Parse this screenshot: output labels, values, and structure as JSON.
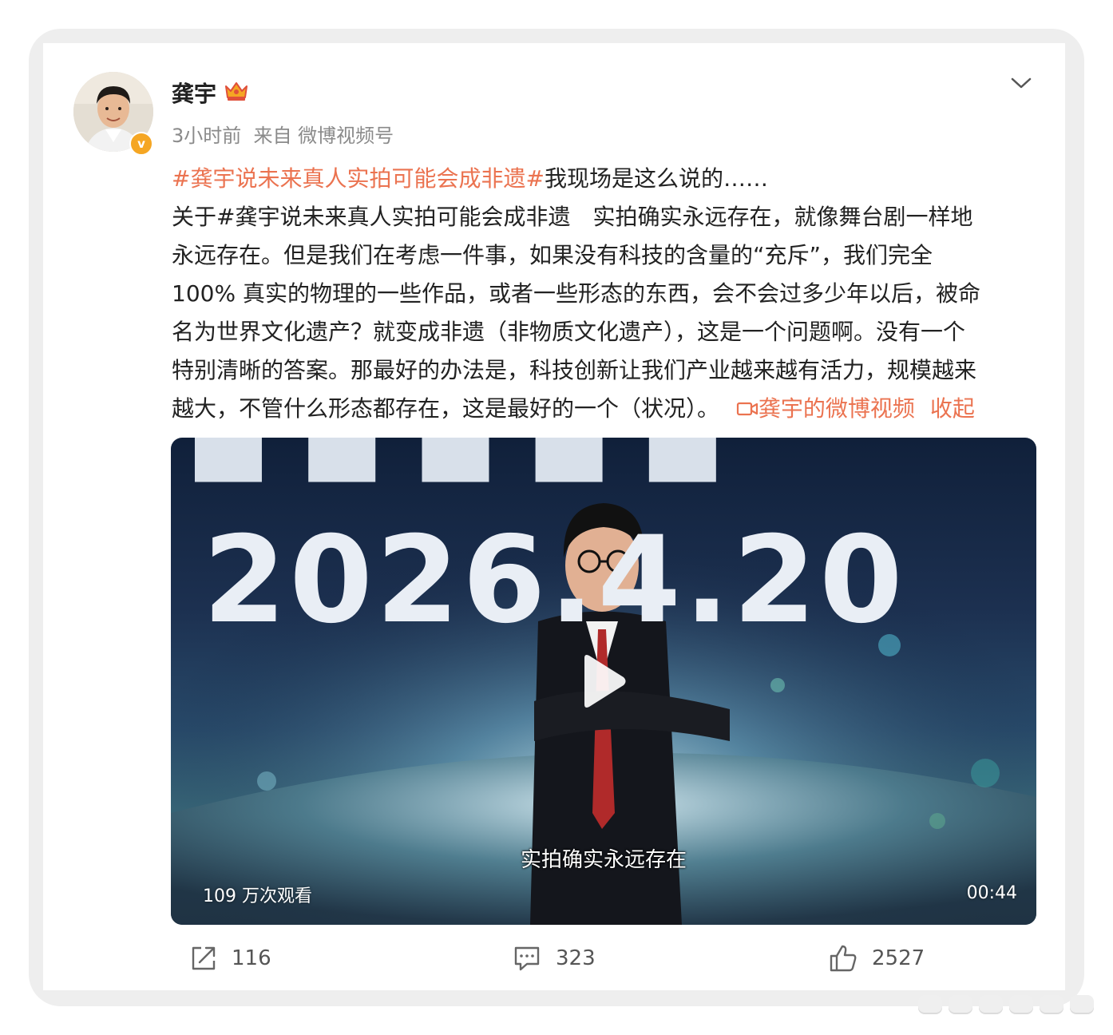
{
  "post": {
    "author": "龚宇",
    "meta": "3小时前  来自 微博视频号",
    "hashtag_title": "#龚宇说未来真人实拍可能会成非遗#",
    "title_rest": "我现场是这么说的……",
    "line1_prefix": "关于",
    "line1_hashtag": "#龚宇说未来真人实拍可能会成非遗",
    "line1_rest": "　实拍确实永远存在，就像舞台剧一样地",
    "line2": "永远存在。但是我们在考虑一件事，如果没有科技的含量的“充斥”，我们完全",
    "line3": "100% 真实的物理的一些作品，或者一些形态的东西，会不会过多少年以后，被命",
    "line4": "名为世界文化遗产？就变成非遗（非物质文化遗产），这是一个问题啊。没有一个",
    "line5": "特别清晰的答案。那最好的办法是，科技创新让我们产业越来越有活力，规模越来",
    "line6": "越大，不管什么形态都存在，这是最好的一个（状况）。",
    "video_link": "龚宇的微博视频",
    "collapse": "收起"
  },
  "video": {
    "big_date": "2026.4.20",
    "subtitle": "实拍确实永远存在",
    "views": "109 万次观看",
    "duration": "00:44"
  },
  "actions": {
    "repost_count": "116",
    "comment_count": "323",
    "like_count": "2527"
  },
  "colors": {
    "accent": "#eb7350",
    "verified": "#f5a623"
  },
  "icons": [
    "crown-icon",
    "chevron-down-icon",
    "play-icon",
    "video-link-icon",
    "repost-icon",
    "comment-icon",
    "like-icon"
  ]
}
